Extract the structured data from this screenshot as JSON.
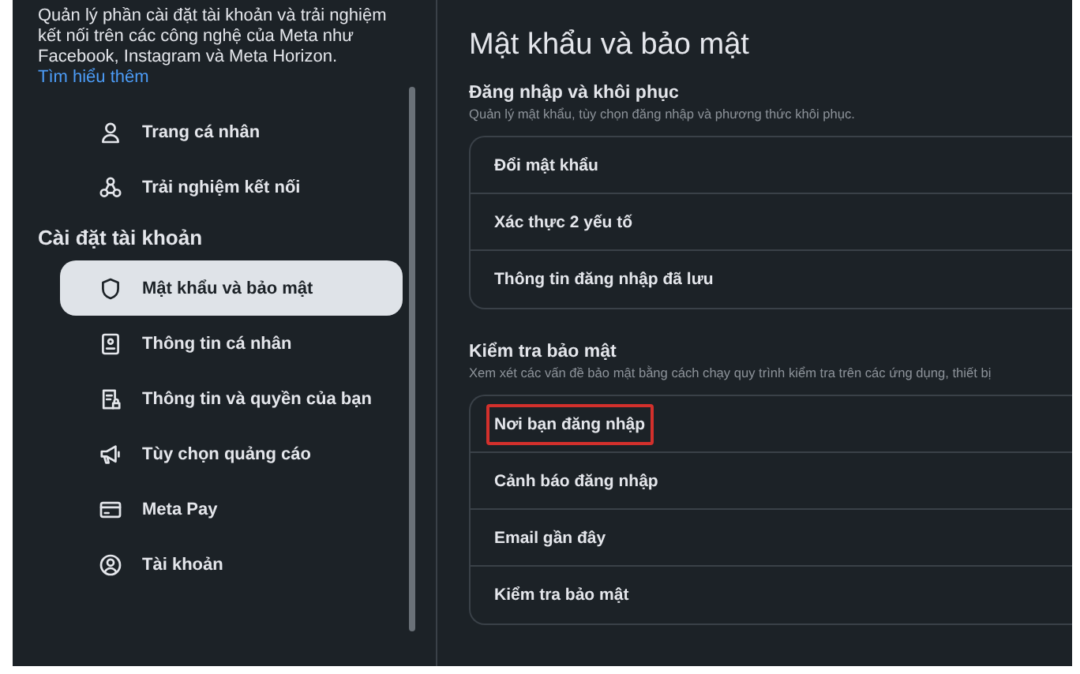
{
  "sidebar": {
    "intro": "Quản lý phần cài đặt tài khoản và trải nghiệm kết nối trên các công nghệ của Meta như Facebook, Instagram và Meta Horizon.",
    "intro_link": "Tìm hiểu thêm",
    "top_items": [
      {
        "label": "Trang cá nhân",
        "selected": false
      },
      {
        "label": "Trải nghiệm kết nối",
        "selected": false
      }
    ],
    "section_title": "Cài đặt tài khoản",
    "account_items": [
      {
        "label": "Mật khẩu và bảo mật",
        "selected": true
      },
      {
        "label": "Thông tin cá nhân",
        "selected": false
      },
      {
        "label": "Thông tin và quyền của bạn",
        "selected": false
      },
      {
        "label": "Tùy chọn quảng cáo",
        "selected": false
      },
      {
        "label": "Meta Pay",
        "selected": false
      },
      {
        "label": "Tài khoản",
        "selected": false
      }
    ]
  },
  "main": {
    "title": "Mật khẩu và bảo mật",
    "sections": [
      {
        "heading": "Đăng nhập và khôi phục",
        "description": "Quản lý mật khẩu, tùy chọn đăng nhập và phương thức khôi phục.",
        "items": [
          {
            "label": "Đổi mật khẩu",
            "highlighted": false
          },
          {
            "label": "Xác thực 2 yếu tố",
            "highlighted": false
          },
          {
            "label": "Thông tin đăng nhập đã lưu",
            "highlighted": false
          }
        ]
      },
      {
        "heading": "Kiểm tra bảo mật",
        "description": "Xem xét các vấn đề bảo mật bằng cách chạy quy trình kiểm tra trên các ứng dụng, thiết bị",
        "items": [
          {
            "label": "Nơi bạn đăng nhập",
            "highlighted": true
          },
          {
            "label": "Cảnh báo đăng nhập",
            "highlighted": false
          },
          {
            "label": "Email gần đây",
            "highlighted": false
          },
          {
            "label": "Kiểm tra bảo mật",
            "highlighted": false
          }
        ]
      }
    ]
  }
}
